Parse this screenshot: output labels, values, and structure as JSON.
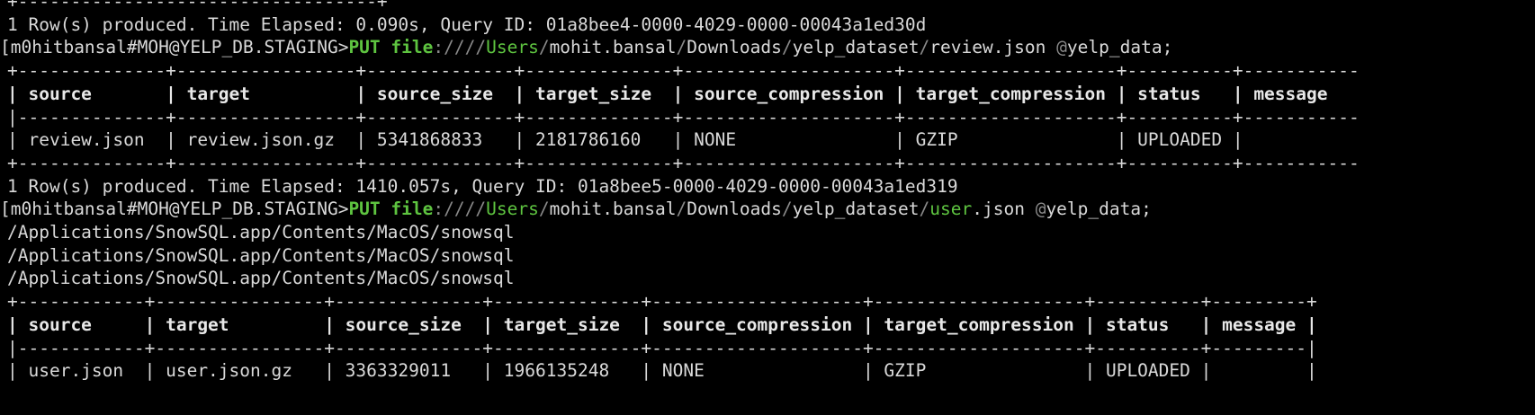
{
  "terminal": {
    "lines": [
      {
        "kind": "border",
        "text": "+----------------------------------+"
      },
      {
        "kind": "plain",
        "text": "1 Row(s) produced. Time Elapsed: 0.090s, Query ID: 01a8bee4-0000-4029-0000-00043a1ed30d"
      },
      {
        "kind": "prompt",
        "prompt": "m0hitbansal#MOH@YELP_DB.STAGING>",
        "cmd": "PUT",
        "scheme": "file",
        "sep1": "://",
        "slashes": "//",
        "p1": "Users",
        "slash1": "/",
        "p2": "mohit.bansal",
        "slash2": "/",
        "p3": "Downloads",
        "slash3": "/",
        "p4": "yelp_dataset",
        "slash4": "/",
        "file_hl": "",
        "file": "review.json",
        "space": " ",
        "stage_at": "@",
        "stage": "yelp_data",
        "end": ";"
      },
      {
        "kind": "border",
        "text": "+--------------+-----------------+--------------+--------------+--------------------+--------------------+----------+-----------"
      },
      {
        "kind": "header",
        "text": "| source       | target          | source_size  | target_size  | source_compression | target_compression | status   | message"
      },
      {
        "kind": "border",
        "text": "|--------------+-----------------+--------------+--------------+--------------------+--------------------+----------+-----------"
      },
      {
        "kind": "plain",
        "text": "| review.json  | review.json.gz  | 5341868833   | 2181786160   | NONE               | GZIP               | UPLOADED |"
      },
      {
        "kind": "border",
        "text": "+--------------+-----------------+--------------+--------------+--------------------+--------------------+----------+-----------"
      },
      {
        "kind": "plain",
        "text": "1 Row(s) produced. Time Elapsed: 1410.057s, Query ID: 01a8bee5-0000-4029-0000-00043a1ed319"
      },
      {
        "kind": "prompt",
        "prompt": "m0hitbansal#MOH@YELP_DB.STAGING>",
        "cmd": "PUT",
        "scheme": "file",
        "sep1": "://",
        "slashes": "//",
        "p1": "Users",
        "slash1": "/",
        "p2": "mohit.bansal",
        "slash2": "/",
        "p3": "Downloads",
        "slash3": "/",
        "p4": "yelp_dataset",
        "slash4": "/",
        "file_hl": "user",
        "file": ".json",
        "space": " ",
        "stage_at": "@",
        "stage": "yelp_data",
        "end": ";"
      },
      {
        "kind": "plain",
        "text": "/Applications/SnowSQL.app/Contents/MacOS/snowsql"
      },
      {
        "kind": "plain",
        "text": "/Applications/SnowSQL.app/Contents/MacOS/snowsql"
      },
      {
        "kind": "plain",
        "text": "/Applications/SnowSQL.app/Contents/MacOS/snowsql"
      },
      {
        "kind": "border",
        "text": "+------------+----------------+--------------+--------------+--------------------+--------------------+----------+---------+"
      },
      {
        "kind": "header",
        "text": "| source     | target         | source_size  | target_size  | source_compression | target_compression | status   | message |"
      },
      {
        "kind": "border",
        "text": "|------------+----------------+--------------+--------------+--------------------+--------------------+----------+---------|"
      },
      {
        "kind": "plain",
        "text": "| user.json  | user.json.gz   | 3363329011   | 1966135248   | NONE               | GZIP               | UPLOADED |         |"
      }
    ]
  }
}
